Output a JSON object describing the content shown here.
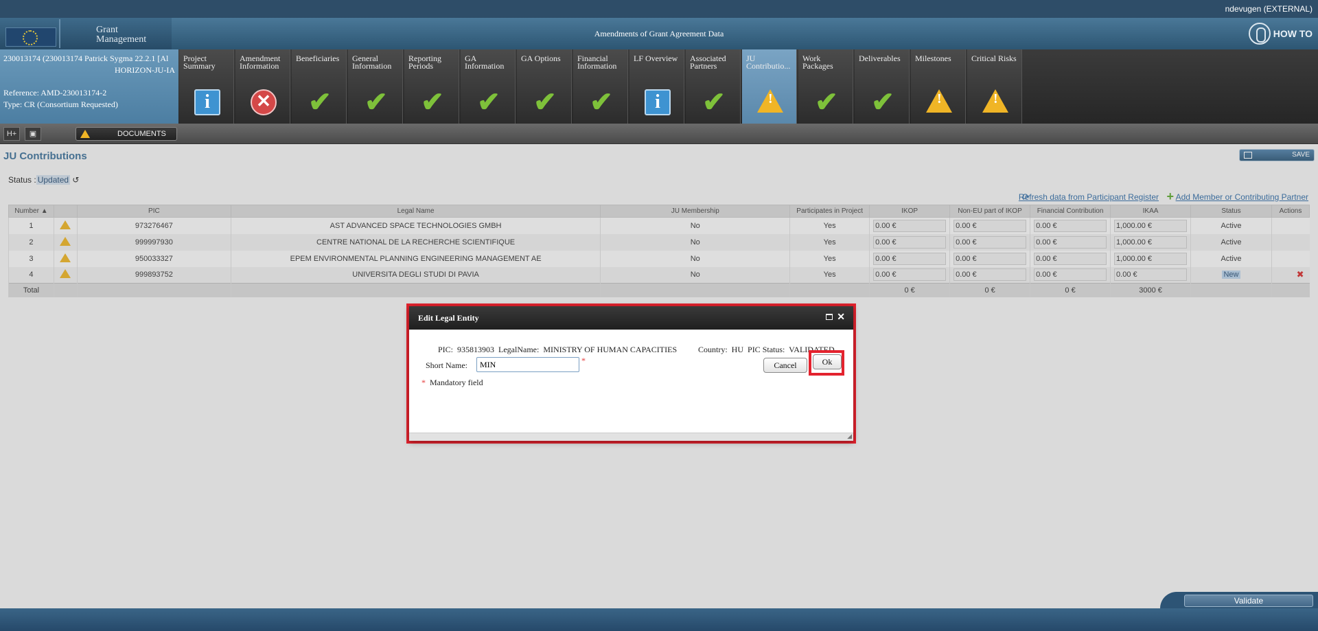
{
  "user": "ndevugen (EXTERNAL)",
  "header": {
    "logo_line1": "Grant",
    "logo_line2": "Management",
    "page_heading": "Amendments of Grant Agreement Data",
    "howto_label": "HOW TO"
  },
  "project": {
    "line1": "230013174 (230013174 Patrick Sygma 22.2.1 [Al",
    "line2": "HORIZON-JU-IA",
    "reference": "Reference: AMD-230013174-2",
    "type": "Type: CR (Consortium Requested)"
  },
  "tabs": [
    {
      "label": "Project Summary",
      "icon": "info-icon"
    },
    {
      "label": "Amendment Information",
      "icon": "error-icon"
    },
    {
      "label": "Beneficiaries",
      "icon": "check-icon"
    },
    {
      "label": "General Information",
      "icon": "check-icon"
    },
    {
      "label": "Reporting Periods",
      "icon": "check-icon"
    },
    {
      "label": "GA Information",
      "icon": "check-icon"
    },
    {
      "label": "GA Options",
      "icon": "check-icon"
    },
    {
      "label": "Financial Information",
      "icon": "check-icon"
    },
    {
      "label": "LF Overview",
      "icon": "info-icon"
    },
    {
      "label": "Associated Partners",
      "icon": "check-icon"
    },
    {
      "label": "JU Contributio...",
      "icon": "warning-icon",
      "active": true
    },
    {
      "label": "Work Packages",
      "icon": "check-icon"
    },
    {
      "label": "Deliverables",
      "icon": "check-icon"
    },
    {
      "label": "Milestones",
      "icon": "warning-icon"
    },
    {
      "label": "Critical Risks",
      "icon": "warning-icon"
    }
  ],
  "toolbar": {
    "btn1_glyph": "H+",
    "btn2_glyph": "▣",
    "documents_label": "DOCUMENTS"
  },
  "section": {
    "title": "JU Contributions",
    "save_label": "SAVE",
    "status_prefix": "Status :",
    "status_value": "Updated",
    "refresh_link": "Refresh data from Participant Register",
    "add_link": "Add Member or Contributing Partner"
  },
  "table": {
    "headers": [
      "Number ▲",
      "",
      "PIC",
      "Legal Name",
      "JU Membership",
      "Participates in Project",
      "IKOP",
      "Non-EU part of IKOP",
      "Financial Contribution",
      "IKAA",
      "Status",
      "Actions"
    ],
    "rows": [
      {
        "num": "1",
        "pic": "973276467",
        "name": "AST ADVANCED SPACE TECHNOLOGIES GMBH",
        "ju": "No",
        "part": "Yes",
        "ikop": "0.00 €",
        "noneu": "0.00 €",
        "fin": "0.00 €",
        "ikaa": "1,000.00 €",
        "status": "Active"
      },
      {
        "num": "2",
        "pic": "999997930",
        "name": "CENTRE NATIONAL DE LA RECHERCHE SCIENTIFIQUE",
        "ju": "No",
        "part": "Yes",
        "ikop": "0.00 €",
        "noneu": "0.00 €",
        "fin": "0.00 €",
        "ikaa": "1,000.00 €",
        "status": "Active"
      },
      {
        "num": "3",
        "pic": "950033327",
        "name": "EPEM ENVIRONMENTAL PLANNING ENGINEERING MANAGEMENT AE",
        "ju": "No",
        "part": "Yes",
        "ikop": "0.00 €",
        "noneu": "0.00 €",
        "fin": "0.00 €",
        "ikaa": "1,000.00 €",
        "status": "Active"
      },
      {
        "num": "4",
        "pic": "999893752",
        "name": "UNIVERSITA DEGLI STUDI DI PAVIA",
        "ju": "No",
        "part": "Yes",
        "ikop": "0.00 €",
        "noneu": "0.00 €",
        "fin": "0.00 €",
        "ikaa": "0.00 €",
        "status": "New"
      }
    ],
    "total": {
      "label": "Total",
      "ikop": "0 €",
      "noneu": "0 €",
      "fin": "0 €",
      "ikaa": "3000 €"
    }
  },
  "dialog": {
    "title": "Edit Legal Entity",
    "pic_label": "PIC:",
    "pic_value": "935813903",
    "legalname_label": "LegalName:",
    "legalname_value": "MINISTRY OF HUMAN CAPACITIES",
    "country_label": "Country:",
    "country_value": "HU",
    "pic_status_label": "PIC Status:",
    "pic_status_value": "VALIDATED",
    "short_name_label": "Short Name:",
    "short_name_value": "MIN",
    "cancel_label": "Cancel",
    "ok_label": "Ok",
    "mandatory_note": "Mandatory field",
    "req_star": "*"
  },
  "footer": {
    "validate_label": "Validate"
  },
  "colors": {
    "highlight_frame": "#e3232e",
    "accent_blue": "#3b6e96",
    "check_green": "#7ec13a",
    "warning_yellow": "#f0b526"
  }
}
